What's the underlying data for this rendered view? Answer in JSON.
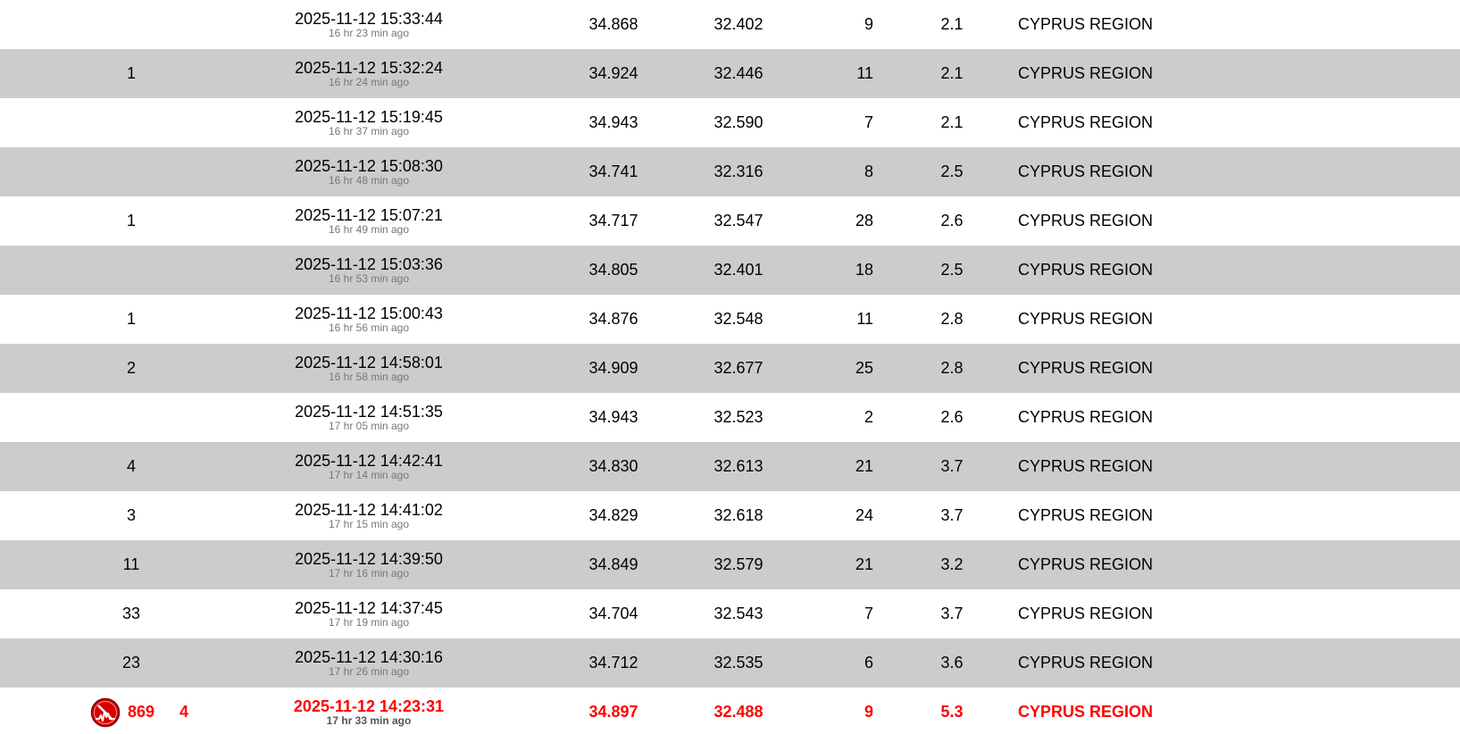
{
  "colors": {
    "alt_row": "#cccccc",
    "major": "#ff0000",
    "ago": "#777777"
  },
  "rows": [
    {
      "felt": "",
      "time": "2025-11-12 15:33:44",
      "ago": "16 hr 23 min ago",
      "lat": "34.868",
      "lon": "32.402",
      "depth": "9",
      "mag": "2.1",
      "region": "CYPRUS REGION"
    },
    {
      "felt": "1",
      "time": "2025-11-12 15:32:24",
      "ago": "16 hr 24 min ago",
      "lat": "34.924",
      "lon": "32.446",
      "depth": "11",
      "mag": "2.1",
      "region": "CYPRUS REGION"
    },
    {
      "felt": "",
      "time": "2025-11-12 15:19:45",
      "ago": "16 hr 37 min ago",
      "lat": "34.943",
      "lon": "32.590",
      "depth": "7",
      "mag": "2.1",
      "region": "CYPRUS REGION"
    },
    {
      "felt": "",
      "time": "2025-11-12 15:08:30",
      "ago": "16 hr 48 min ago",
      "lat": "34.741",
      "lon": "32.316",
      "depth": "8",
      "mag": "2.5",
      "region": "CYPRUS REGION"
    },
    {
      "felt": "1",
      "time": "2025-11-12 15:07:21",
      "ago": "16 hr 49 min ago",
      "lat": "34.717",
      "lon": "32.547",
      "depth": "28",
      "mag": "2.6",
      "region": "CYPRUS REGION"
    },
    {
      "felt": "",
      "time": "2025-11-12 15:03:36",
      "ago": "16 hr 53 min ago",
      "lat": "34.805",
      "lon": "32.401",
      "depth": "18",
      "mag": "2.5",
      "region": "CYPRUS REGION"
    },
    {
      "felt": "1",
      "time": "2025-11-12 15:00:43",
      "ago": "16 hr 56 min ago",
      "lat": "34.876",
      "lon": "32.548",
      "depth": "11",
      "mag": "2.8",
      "region": "CYPRUS REGION"
    },
    {
      "felt": "2",
      "time": "2025-11-12 14:58:01",
      "ago": "16 hr 58 min ago",
      "lat": "34.909",
      "lon": "32.677",
      "depth": "25",
      "mag": "2.8",
      "region": "CYPRUS REGION"
    },
    {
      "felt": "",
      "time": "2025-11-12 14:51:35",
      "ago": "17 hr 05 min ago",
      "lat": "34.943",
      "lon": "32.523",
      "depth": "2",
      "mag": "2.6",
      "region": "CYPRUS REGION"
    },
    {
      "felt": "4",
      "time": "2025-11-12 14:42:41",
      "ago": "17 hr 14 min ago",
      "lat": "34.830",
      "lon": "32.613",
      "depth": "21",
      "mag": "3.7",
      "region": "CYPRUS REGION"
    },
    {
      "felt": "3",
      "time": "2025-11-12 14:41:02",
      "ago": "17 hr 15 min ago",
      "lat": "34.829",
      "lon": "32.618",
      "depth": "24",
      "mag": "3.7",
      "region": "CYPRUS REGION"
    },
    {
      "felt": "11",
      "time": "2025-11-12 14:39:50",
      "ago": "17 hr 16 min ago",
      "lat": "34.849",
      "lon": "32.579",
      "depth": "21",
      "mag": "3.2",
      "region": "CYPRUS REGION"
    },
    {
      "felt": "33",
      "time": "2025-11-12 14:37:45",
      "ago": "17 hr 19 min ago",
      "lat": "34.704",
      "lon": "32.543",
      "depth": "7",
      "mag": "3.7",
      "region": "CYPRUS REGION"
    },
    {
      "felt": "23",
      "time": "2025-11-12 14:30:16",
      "ago": "17 hr 26 min ago",
      "lat": "34.712",
      "lon": "32.535",
      "depth": "6",
      "mag": "3.6",
      "region": "CYPRUS REGION"
    }
  ],
  "major": {
    "icon": "seismograph-icon",
    "reports": "869",
    "felt": "4",
    "time": "2025-11-12 14:23:31",
    "ago": "17 hr 33 min ago",
    "lat": "34.897",
    "lon": "32.488",
    "depth": "9",
    "mag": "5.3",
    "region": "CYPRUS REGION"
  }
}
